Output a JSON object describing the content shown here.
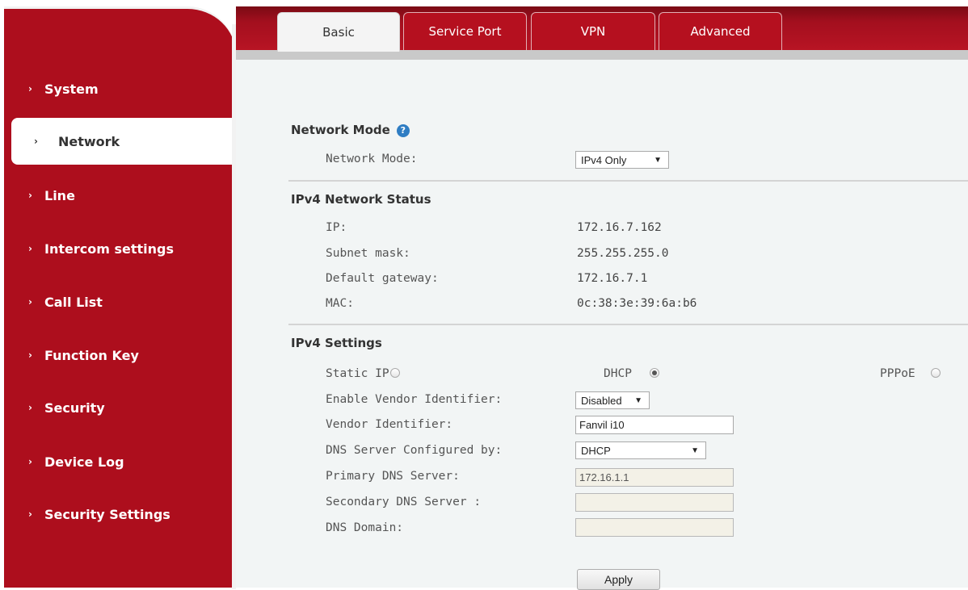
{
  "sidebar": {
    "items": [
      {
        "label": "System"
      },
      {
        "label": "Network"
      },
      {
        "label": "Line"
      },
      {
        "label": "Intercom settings"
      },
      {
        "label": "Call List"
      },
      {
        "label": "Function Key"
      },
      {
        "label": "Security"
      },
      {
        "label": "Device Log"
      },
      {
        "label": "Security Settings"
      }
    ],
    "chevron": "›"
  },
  "tabs": [
    {
      "label": "Basic"
    },
    {
      "label": "Service Port"
    },
    {
      "label": "VPN"
    },
    {
      "label": "Advanced"
    }
  ],
  "network_mode": {
    "title": "Network Mode",
    "help_icon": "?",
    "label": "Network Mode:",
    "value": "IPv4 Only"
  },
  "ipv4_status": {
    "title": "IPv4 Network Status",
    "ip_label": "IP:",
    "ip": "172.16.7.162",
    "subnet_label": "Subnet mask:",
    "subnet": "255.255.255.0",
    "gateway_label": "Default gateway:",
    "gateway": "172.16.7.1",
    "mac_label": "MAC:",
    "mac": "0c:38:3e:39:6a:b6"
  },
  "ipv4_settings": {
    "title": "IPv4 Settings",
    "static_ip_label": "Static IP",
    "dhcp_label": "DHCP",
    "pppoe_label": "PPPoE",
    "selected_mode": "DHCP",
    "vendor_enable_label": "Enable Vendor Identifier:",
    "vendor_enable_value": "Disabled",
    "vendor_id_label": "Vendor Identifier:",
    "vendor_id_value": "Fanvil i10",
    "dns_config_label": "DNS Server Configured by:",
    "dns_config_value": "DHCP",
    "primary_dns_label": "Primary DNS Server:",
    "primary_dns_value": "172.16.1.1",
    "secondary_dns_label": "Secondary DNS Server :",
    "secondary_dns_value": "",
    "dns_domain_label": "DNS Domain:",
    "dns_domain_value": ""
  },
  "apply_label": "Apply",
  "colors": {
    "sidebar_red": "#ad0e1d",
    "tab_red": "#b5101f",
    "content_bg": "#f2f5f5",
    "help_blue": "#2f7dc3"
  }
}
